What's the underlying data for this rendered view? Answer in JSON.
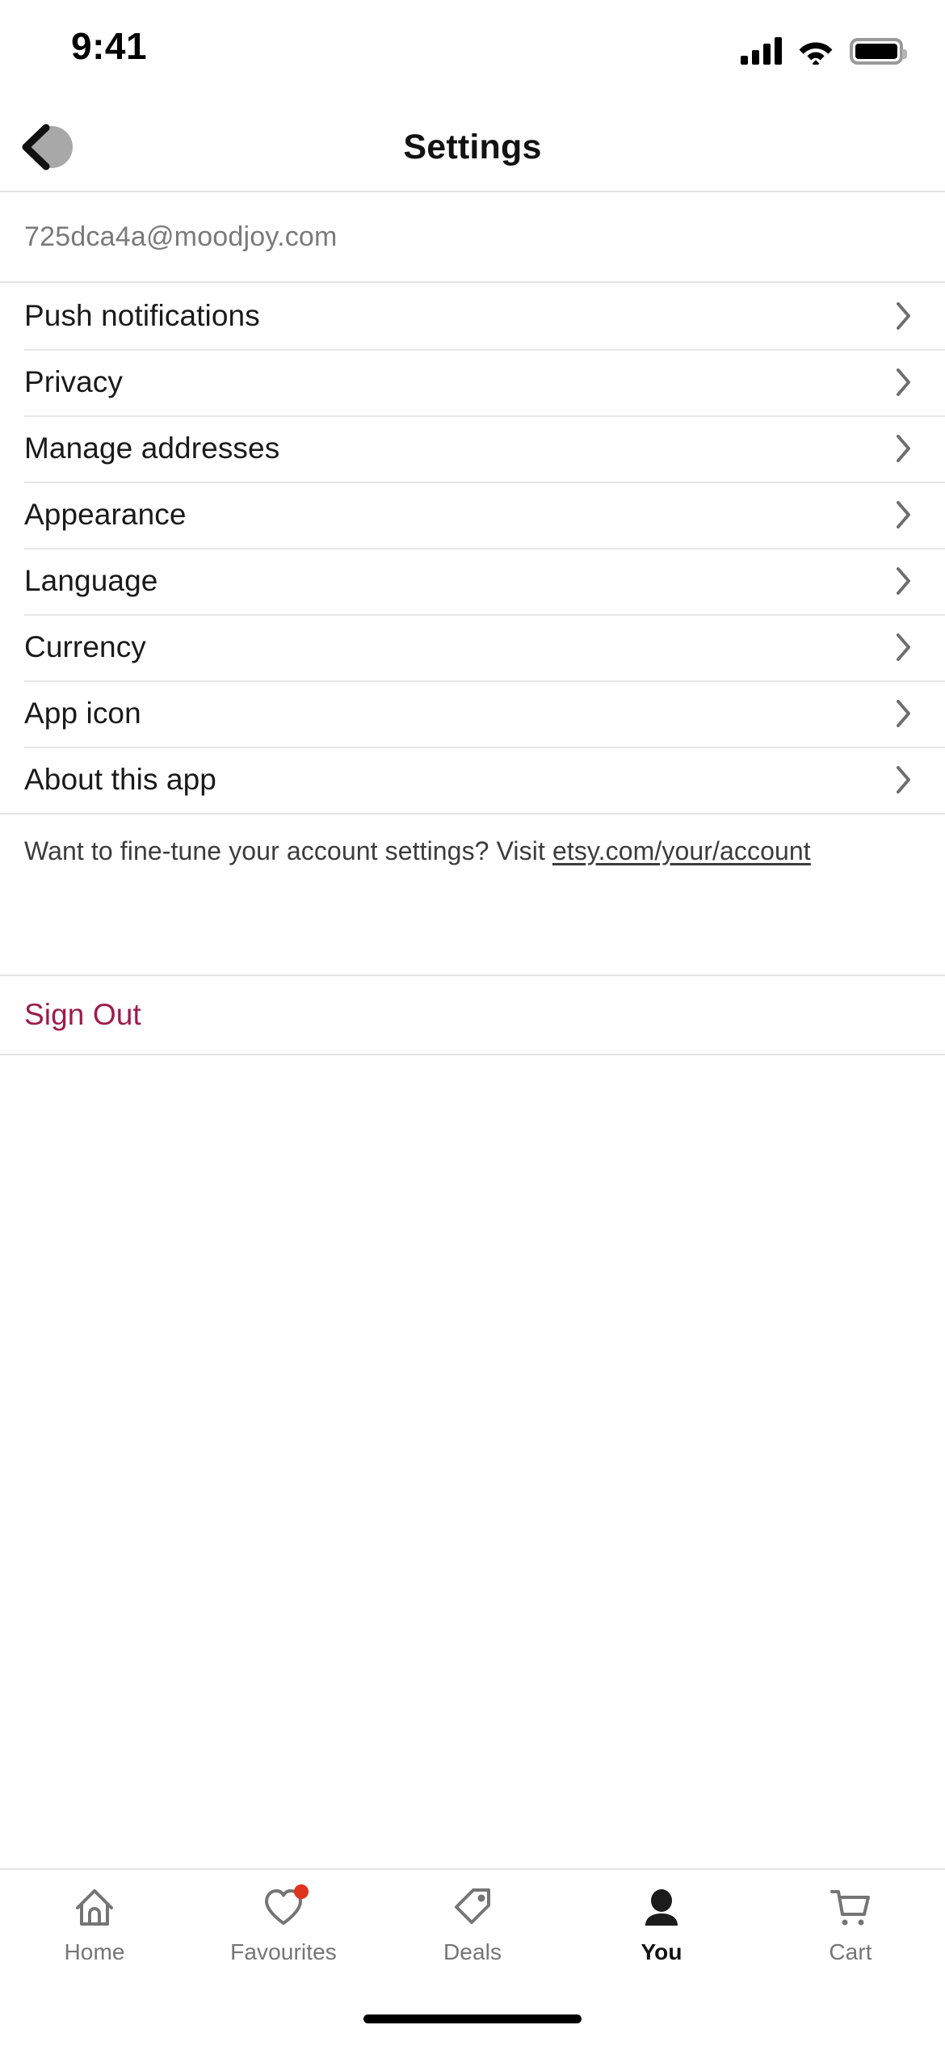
{
  "status_bar": {
    "time": "9:41",
    "cellular_icon": "cellular-signal-icon",
    "wifi_icon": "wifi-icon",
    "battery_icon": "battery-full-icon"
  },
  "header": {
    "title": "Settings",
    "back_icon": "back-chevron-icon"
  },
  "account": {
    "email": "725dca4a@moodjoy.com"
  },
  "settings_list": [
    {
      "label": "Push notifications",
      "chevron": "chevron-right-icon"
    },
    {
      "label": "Privacy",
      "chevron": "chevron-right-icon"
    },
    {
      "label": "Manage addresses",
      "chevron": "chevron-right-icon"
    },
    {
      "label": "Appearance",
      "chevron": "chevron-right-icon"
    },
    {
      "label": "Language",
      "chevron": "chevron-right-icon"
    },
    {
      "label": "Currency",
      "chevron": "chevron-right-icon"
    },
    {
      "label": "App icon",
      "chevron": "chevron-right-icon"
    },
    {
      "label": "About this app",
      "chevron": "chevron-right-icon"
    }
  ],
  "footer_note": {
    "text_before": "Want to fine-tune your account settings? Visit ",
    "link_text": "etsy.com/your/account"
  },
  "sign_out": {
    "label": "Sign Out",
    "color": "#9e1b4d"
  },
  "tab_bar": {
    "items": [
      {
        "label": "Home",
        "icon": "home-icon",
        "active": false,
        "badge": false
      },
      {
        "label": "Favourites",
        "icon": "heart-icon",
        "active": false,
        "badge": true
      },
      {
        "label": "Deals",
        "icon": "tag-icon",
        "active": false,
        "badge": false
      },
      {
        "label": "You",
        "icon": "person-icon",
        "active": true,
        "badge": false
      },
      {
        "label": "Cart",
        "icon": "shopping-cart-icon",
        "active": false,
        "badge": false
      }
    ],
    "badge_color": "#e0341f",
    "active_color": "#111111",
    "inactive_color": "#757575"
  },
  "home_indicator": "home-indicator"
}
